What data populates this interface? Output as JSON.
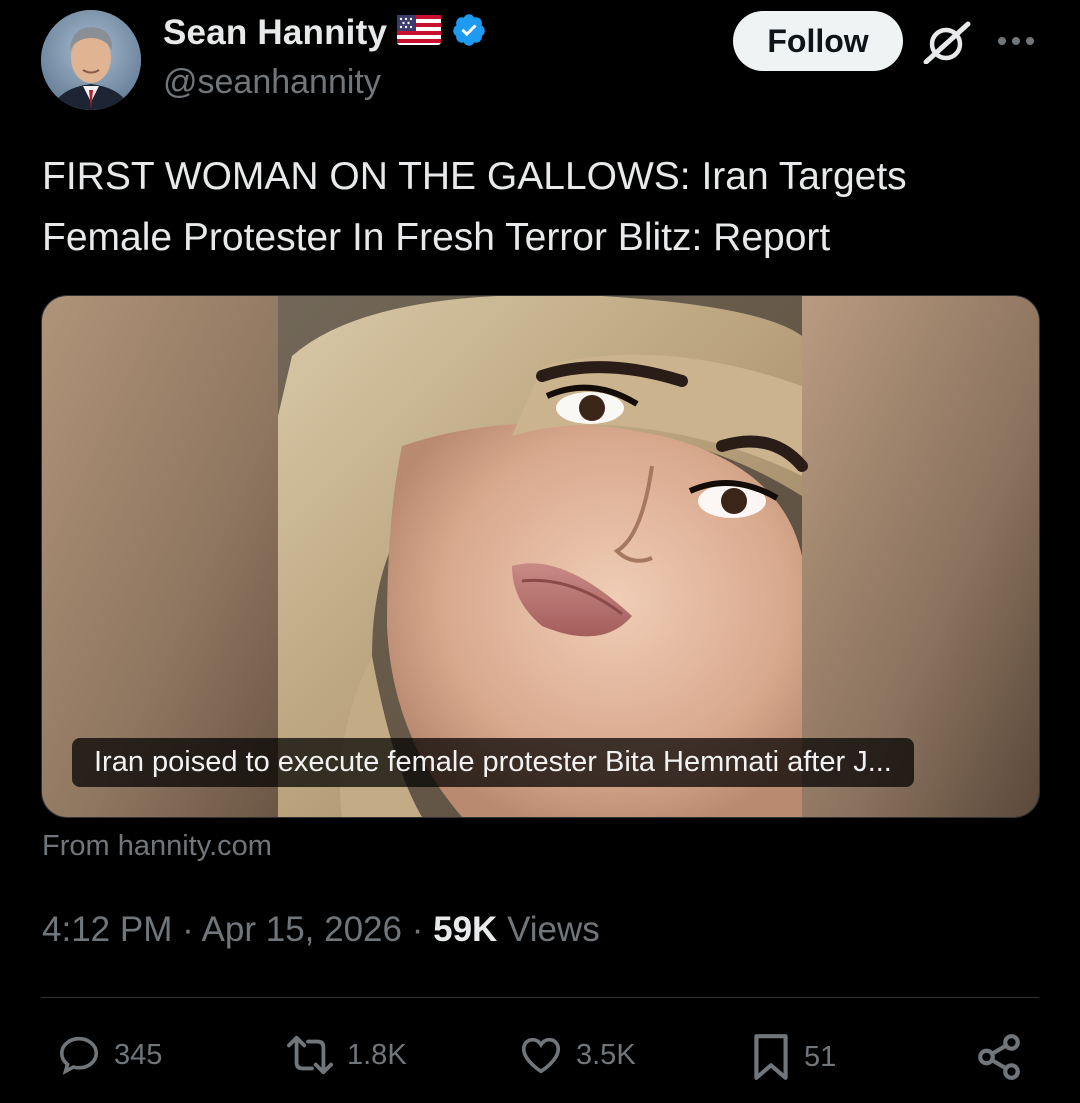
{
  "author": {
    "name": "Sean Hannity",
    "handle": "@seanhannity",
    "flag_icon": "us-flag-icon",
    "verified_icon": "verified-badge-icon",
    "verified_color": "#1d9bf0"
  },
  "header": {
    "follow_label": "Follow",
    "grok_icon": "grok-icon",
    "more_icon": "more-options-icon"
  },
  "tweet": {
    "text": "FIRST WOMAN ON THE GALLOWS: Iran Targets Female Protester In Fresh Terror Blitz: Report"
  },
  "card": {
    "caption": "Iran poised to execute female protester Bita Hemmati after J...",
    "source": "From hannity.com"
  },
  "meta": {
    "time": "4:12 PM",
    "date": "Apr 15, 2026",
    "views_count": "59K",
    "views_label": "Views",
    "separator": "·"
  },
  "actions": {
    "replies": "345",
    "reposts": "1.8K",
    "likes": "3.5K",
    "bookmarks": "51"
  },
  "colors": {
    "background": "#000000",
    "text_primary": "#e7e9ea",
    "text_secondary": "#71767b",
    "border": "#2f3336",
    "follow_bg": "#eff3f4"
  }
}
